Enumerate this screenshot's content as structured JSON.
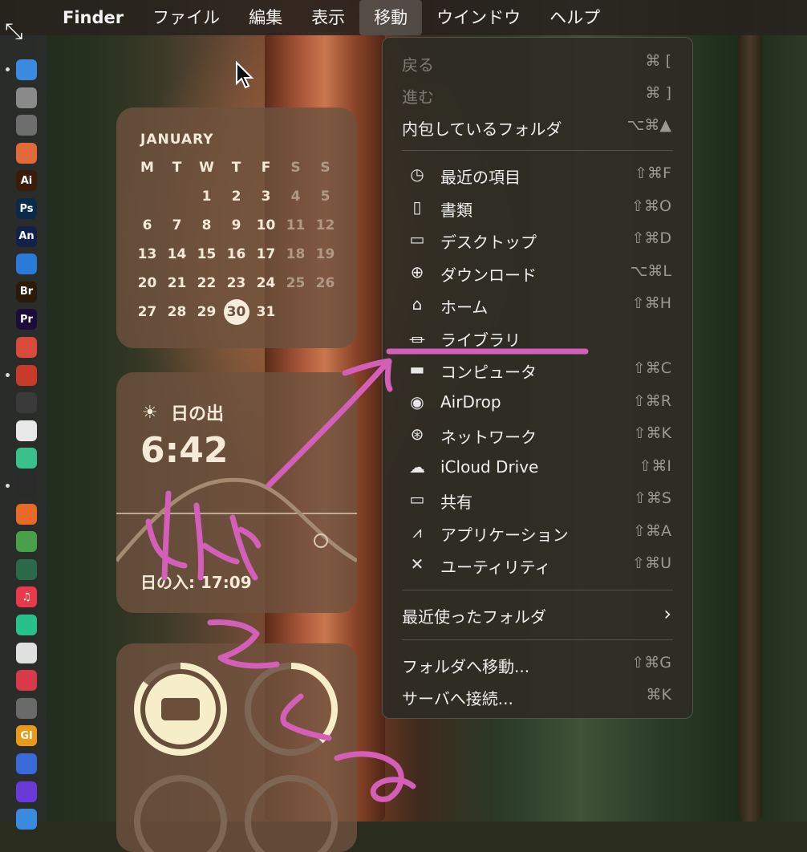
{
  "menubar": {
    "items": [
      "Finder",
      "ファイル",
      "編集",
      "表示",
      "移動",
      "ウインドウ",
      "ヘルプ"
    ]
  },
  "calendar": {
    "month": "JANUARY",
    "weekdays": [
      "M",
      "T",
      "W",
      "T",
      "F",
      "S",
      "S"
    ],
    "weeks": [
      [
        "",
        "",
        "1",
        "2",
        "3",
        "4",
        "5"
      ],
      [
        "6",
        "7",
        "8",
        "9",
        "10",
        "11",
        "12"
      ],
      [
        "13",
        "14",
        "15",
        "16",
        "17",
        "18",
        "19"
      ],
      [
        "20",
        "21",
        "22",
        "23",
        "24",
        "25",
        "26"
      ],
      [
        "27",
        "28",
        "29",
        "30",
        "31",
        "",
        ""
      ]
    ],
    "today": "30"
  },
  "sunrise": {
    "label": "日の出",
    "time": "6:42",
    "sunset": "日の入: 17:09"
  },
  "go_menu": {
    "back": {
      "label": "戻る",
      "shortcut": "⌘ ["
    },
    "forward": {
      "label": "進む",
      "shortcut": "⌘ ]"
    },
    "enclosing": {
      "label": "内包しているフォルダ",
      "shortcut": "⌥⌘▲"
    },
    "places": [
      {
        "label": "最近の項目",
        "shortcut": "⇧⌘F",
        "icon": "clock-icon"
      },
      {
        "label": "書類",
        "shortcut": "⇧⌘O",
        "icon": "document-icon"
      },
      {
        "label": "デスクトップ",
        "shortcut": "⇧⌘D",
        "icon": "desktop-icon"
      },
      {
        "label": "ダウンロード",
        "shortcut": "⌥⌘L",
        "icon": "download-icon"
      },
      {
        "label": "ホーム",
        "shortcut": "⇧⌘H",
        "icon": "home-icon"
      },
      {
        "label": "ライブラリ",
        "shortcut": "",
        "icon": "library-icon"
      },
      {
        "label": "コンピュータ",
        "shortcut": "⇧⌘C",
        "icon": "computer-icon"
      },
      {
        "label": "AirDrop",
        "shortcut": "⇧⌘R",
        "icon": "airdrop-icon"
      },
      {
        "label": "ネットワーク",
        "shortcut": "⇧⌘K",
        "icon": "globe-icon"
      },
      {
        "label": "iCloud Drive",
        "shortcut": "⇧⌘I",
        "icon": "cloud-icon"
      },
      {
        "label": "共有",
        "shortcut": "⇧⌘S",
        "icon": "shared-folder-icon"
      },
      {
        "label": "アプリケーション",
        "shortcut": "⇧⌘A",
        "icon": "applications-icon"
      },
      {
        "label": "ユーティリティ",
        "shortcut": "⇧⌘U",
        "icon": "utilities-icon"
      }
    ],
    "recent_folders": {
      "label": "最近使ったフォルダ"
    },
    "go_to_folder": {
      "label": "フォルダへ移動...",
      "shortcut": "⇧⌘G"
    },
    "connect_server": {
      "label": "サーバへ接続...",
      "shortcut": "⌘K"
    }
  },
  "dock": {
    "icons": [
      {
        "name": "finder-icon",
        "text": "",
        "color": "#3a8be0"
      },
      {
        "name": "system-settings-icon",
        "text": "",
        "color": "#8a8a8a"
      },
      {
        "name": "calculator-icon",
        "text": "",
        "color": "#6e6e6e"
      },
      {
        "name": "launchpad-icon",
        "text": "",
        "color": "#e06a3a"
      },
      {
        "name": "illustrator-icon",
        "text": "Ai",
        "color": "#3a1c08"
      },
      {
        "name": "photoshop-icon",
        "text": "Ps",
        "color": "#0a2a4a"
      },
      {
        "name": "animate-icon",
        "text": "An",
        "color": "#12204a"
      },
      {
        "name": "safari-icon",
        "text": "",
        "color": "#2a7ad8"
      },
      {
        "name": "bridge-icon",
        "text": "Br",
        "color": "#2a1a08"
      },
      {
        "name": "premiere-icon",
        "text": "Pr",
        "color": "#1c0c3a"
      },
      {
        "name": "chrome-icon",
        "text": "",
        "color": "#d84a3a"
      },
      {
        "name": "app-icon",
        "text": "",
        "color": "#c83a2a"
      },
      {
        "name": "app-icon",
        "text": "",
        "color": "#3a3a3a"
      },
      {
        "name": "app-icon",
        "text": "",
        "color": "#e8e8e8"
      },
      {
        "name": "app-icon",
        "text": "",
        "color": "#3ac08a"
      },
      {
        "name": "blender-icon",
        "text": "",
        "color": "#2a2a2a"
      },
      {
        "name": "app-icon",
        "text": "",
        "color": "#e86a2a"
      },
      {
        "name": "app-icon",
        "text": "",
        "color": "#4aa04a"
      },
      {
        "name": "app-icon",
        "text": "",
        "color": "#2a6a4a"
      },
      {
        "name": "music-icon",
        "text": "♫",
        "color": "#e83a4a"
      },
      {
        "name": "app-icon",
        "text": "",
        "color": "#2ac08a"
      },
      {
        "name": "textedit-icon",
        "text": "",
        "color": "#e0e0e0"
      },
      {
        "name": "creative-cloud-icon",
        "text": "",
        "color": "#d83a4a"
      },
      {
        "name": "screenshot-icon",
        "text": "",
        "color": "#6a6a6a"
      },
      {
        "name": "app-icon",
        "text": "Gl",
        "color": "#e89a1a"
      },
      {
        "name": "app-icon",
        "text": "",
        "color": "#3a6ad8"
      },
      {
        "name": "siri-icon",
        "text": "",
        "color": "#6a3ad8"
      },
      {
        "name": "app-icon",
        "text": "",
        "color": "#3a8ae0"
      }
    ]
  }
}
